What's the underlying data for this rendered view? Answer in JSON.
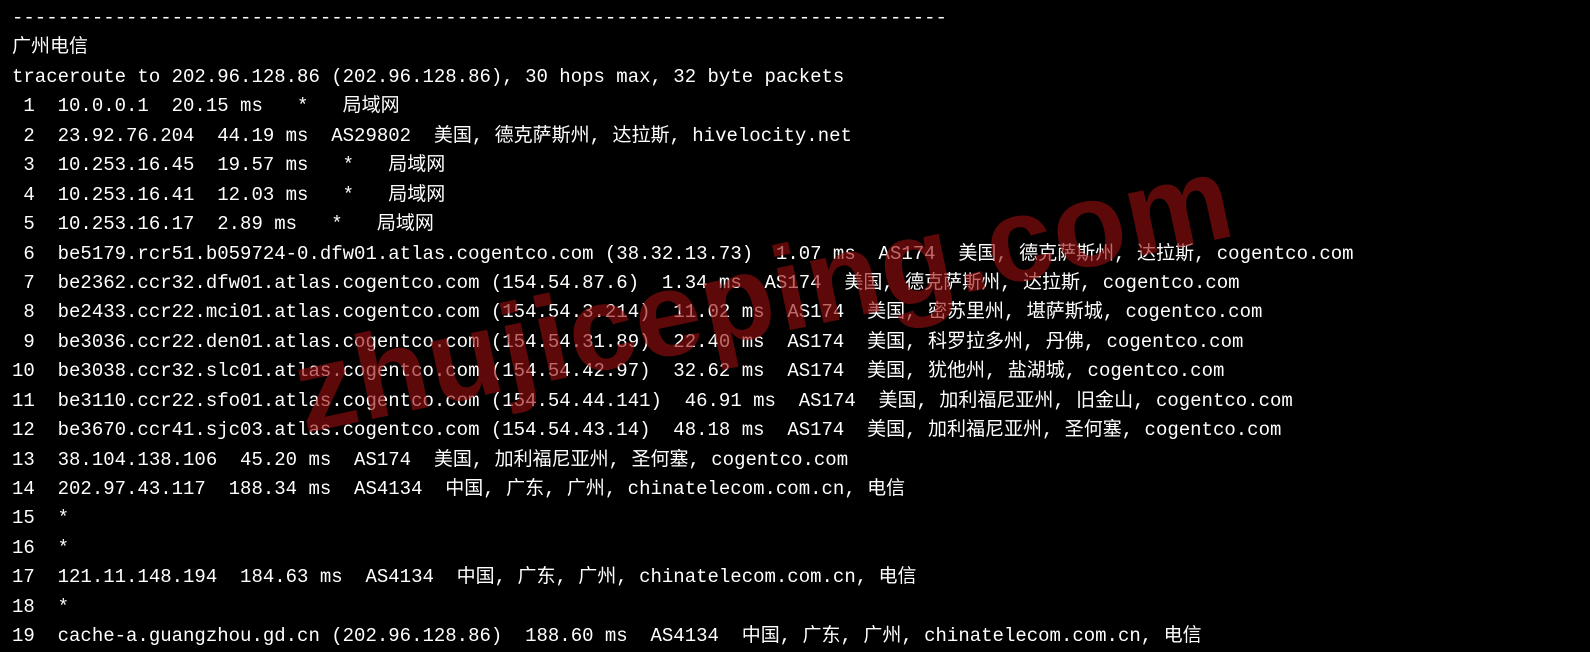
{
  "divider": "----------------------------------------------------------------------------------",
  "header_label": "广州电信",
  "traceroute_line": "traceroute to 202.96.128.86 (202.96.128.86), 30 hops max, 32 byte packets",
  "watermark": "zhujiceping.com",
  "hops": [
    {
      "n": " 1",
      "text": "10.0.0.1  20.15 ms   *   局域网"
    },
    {
      "n": " 2",
      "text": "23.92.76.204  44.19 ms  AS29802  美国, 德克萨斯州, 达拉斯, hivelocity.net"
    },
    {
      "n": " 3",
      "text": "10.253.16.45  19.57 ms   *   局域网"
    },
    {
      "n": " 4",
      "text": "10.253.16.41  12.03 ms   *   局域网"
    },
    {
      "n": " 5",
      "text": "10.253.16.17  2.89 ms   *   局域网"
    },
    {
      "n": " 6",
      "text": "be5179.rcr51.b059724-0.dfw01.atlas.cogentco.com (38.32.13.73)  1.07 ms  AS174  美国, 德克萨斯州, 达拉斯, cogentco.com"
    },
    {
      "n": " 7",
      "text": "be2362.ccr32.dfw01.atlas.cogentco.com (154.54.87.6)  1.34 ms  AS174  美国, 德克萨斯州, 达拉斯, cogentco.com"
    },
    {
      "n": " 8",
      "text": "be2433.ccr22.mci01.atlas.cogentco.com (154.54.3.214)  11.02 ms  AS174  美国, 密苏里州, 堪萨斯城, cogentco.com"
    },
    {
      "n": " 9",
      "text": "be3036.ccr22.den01.atlas.cogentco.com (154.54.31.89)  22.40 ms  AS174  美国, 科罗拉多州, 丹佛, cogentco.com"
    },
    {
      "n": "10",
      "text": "be3038.ccr32.slc01.atlas.cogentco.com (154.54.42.97)  32.62 ms  AS174  美国, 犹他州, 盐湖城, cogentco.com"
    },
    {
      "n": "11",
      "text": "be3110.ccr22.sfo01.atlas.cogentco.com (154.54.44.141)  46.91 ms  AS174  美国, 加利福尼亚州, 旧金山, cogentco.com"
    },
    {
      "n": "12",
      "text": "be3670.ccr41.sjc03.atlas.cogentco.com (154.54.43.14)  48.18 ms  AS174  美国, 加利福尼亚州, 圣何塞, cogentco.com"
    },
    {
      "n": "13",
      "text": "38.104.138.106  45.20 ms  AS174  美国, 加利福尼亚州, 圣何塞, cogentco.com"
    },
    {
      "n": "14",
      "text": "202.97.43.117  188.34 ms  AS4134  中国, 广东, 广州, chinatelecom.com.cn, 电信"
    },
    {
      "n": "15",
      "text": "*"
    },
    {
      "n": "16",
      "text": "*"
    },
    {
      "n": "17",
      "text": "121.11.148.194  184.63 ms  AS4134  中国, 广东, 广州, chinatelecom.com.cn, 电信"
    },
    {
      "n": "18",
      "text": "*"
    },
    {
      "n": "19",
      "text": "cache-a.guangzhou.gd.cn (202.96.128.86)  188.60 ms  AS4134  中国, 广东, 广州, chinatelecom.com.cn, 电信"
    }
  ]
}
